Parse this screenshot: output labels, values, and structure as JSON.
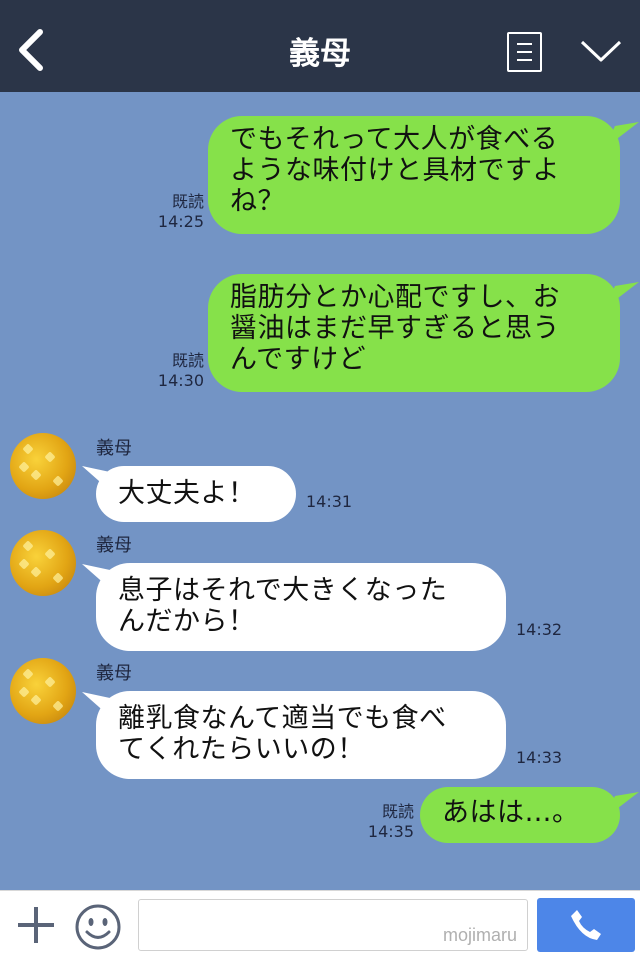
{
  "header": {
    "title": "義母"
  },
  "messages": [
    {
      "from": "me",
      "text": [
        "でもそれって大人が食べる",
        "ような味付けと具材ですよ",
        "ね？"
      ],
      "read": "既読",
      "time": "14:25"
    },
    {
      "from": "me",
      "text": [
        "脂肪分とか心配ですし、お",
        "醤油はまだ早すぎると思う",
        "んですけど"
      ],
      "read": "既読",
      "time": "14:30"
    },
    {
      "from": "them",
      "sender": "義母",
      "text": [
        "大丈夫よ！"
      ],
      "time": "14:31"
    },
    {
      "from": "them",
      "sender": "義母",
      "text": [
        "息子はそれで大きくなった",
        "んだから！"
      ],
      "time": "14:32"
    },
    {
      "from": "them",
      "sender": "義母",
      "text": [
        "離乳食なんて適当でも食べ",
        "てくれたらいいの！"
      ],
      "time": "14:33"
    },
    {
      "from": "me",
      "text": [
        "あはは…。"
      ],
      "read": "既読",
      "time": "14:35"
    }
  ],
  "input": {
    "placeholder": "",
    "watermark": "mojimaru"
  },
  "icons": {
    "back": "chevron-left-icon",
    "menu": "list-icon",
    "collapse": "chevron-down-icon",
    "add": "plus-icon",
    "emoji": "smiley-icon",
    "call": "phone-icon"
  },
  "colors": {
    "header_bg": "#2b3548",
    "chat_bg": "#7394c5",
    "my_bubble": "#86e14a",
    "their_bubble": "#ffffff",
    "call_button": "#4d86e8"
  }
}
